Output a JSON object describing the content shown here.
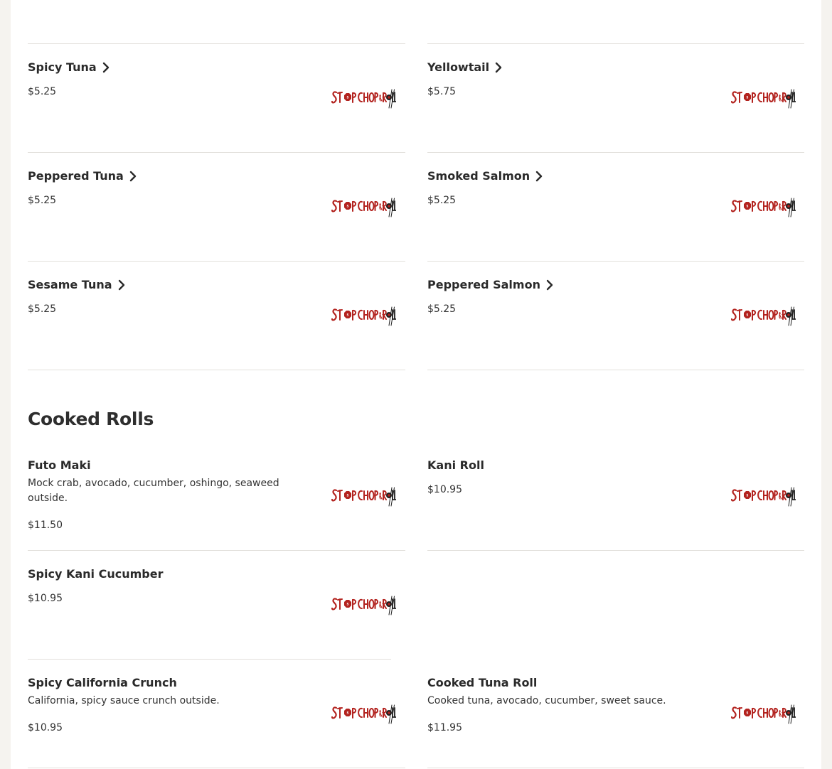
{
  "brand": {
    "logo_text": "STOP CHOP & ROLL",
    "logo_icon": "stop-chop-roll-logo",
    "colors": {
      "red": "#b3231f",
      "dark": "#2a2a2a"
    }
  },
  "sections": {
    "sashimi_items": [
      {
        "name": "Spicy Tuna",
        "price": "$5.25"
      },
      {
        "name": "Yellowtail",
        "price": "$5.75"
      },
      {
        "name": "Peppered Tuna",
        "price": "$5.25"
      },
      {
        "name": "Smoked Salmon",
        "price": "$5.25"
      },
      {
        "name": "Sesame Tuna",
        "price": "$5.25"
      },
      {
        "name": "Peppered Salmon",
        "price": "$5.25"
      }
    ],
    "cooked_rolls": {
      "title": "Cooked Rolls",
      "items": [
        {
          "name": "Futo Maki",
          "description": "Mock crab, avocado, cucumber, oshingo, seaweed outside.",
          "price": "$11.50"
        },
        {
          "name": "Kani Roll",
          "price": "$10.95"
        },
        {
          "name": "Spicy Kani Cucumber",
          "price": "$10.95"
        },
        {
          "name": "Spicy California Crunch",
          "description": "California, spicy sauce crunch outside.",
          "price": "$10.95"
        },
        {
          "name": "Cooked Tuna Roll",
          "description": "Cooked tuna, avocado, cucumber, sweet sauce.",
          "price": "$11.95"
        }
      ]
    }
  }
}
